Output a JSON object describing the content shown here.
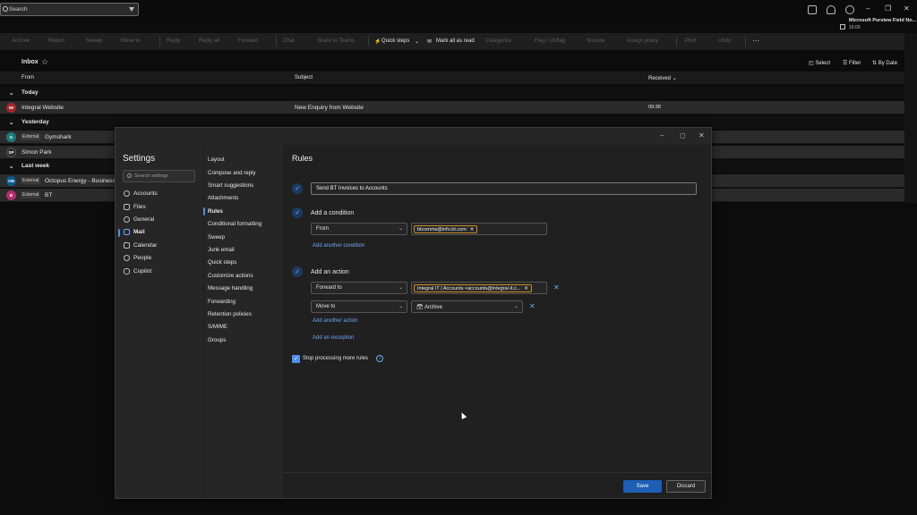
{
  "search": {
    "placeholder": "Search"
  },
  "purview": {
    "title": "Microsoft Purview Field No...",
    "time": "15:00"
  },
  "toolbar": {
    "archive": "Archive",
    "report": "Report",
    "sweep": "Sweep",
    "move_to": "Move to",
    "reply": "Reply",
    "reply_all": "Reply all",
    "forward": "Forward",
    "chat": "Chat",
    "share_teams": "Share to Teams",
    "quick_steps": "Quick steps",
    "mark_all_read": "Mark all as read",
    "categorize": "Categorize",
    "flag": "Flag / Unflag",
    "snooze": "Snooze",
    "assign_policy": "Assign policy",
    "print": "Print",
    "undo": "Undo",
    "more": "···"
  },
  "inbox": {
    "title": "Inbox",
    "select": "Select",
    "filter": "Filter",
    "by_date": "By Date"
  },
  "columns": {
    "from": "From",
    "subject": "Subject",
    "received": "Received"
  },
  "groups": {
    "today": "Today",
    "yesterday": "Yesterday",
    "last_week": "Last week"
  },
  "messages": [
    {
      "initials": "IW",
      "from": "Integral Website",
      "subject": "New Enquiry from Website",
      "received": "09:38",
      "external": "",
      "color": "#a4262c"
    },
    {
      "initials": "G",
      "from": "Gymshark",
      "external": "External",
      "color": "#1f7a7a"
    },
    {
      "initials": "SP",
      "from": "Simon Park",
      "external": "",
      "color": "#2b2b2b"
    },
    {
      "initials": "OB",
      "from": "Octopus Energy - Business",
      "external": "External",
      "color": "#0e5a8a"
    },
    {
      "initials": "B",
      "from": "BT",
      "external": "External",
      "color": "#b0306b"
    }
  ],
  "settings": {
    "title": "Settings",
    "search_placeholder": "Search settings",
    "nav": [
      "Accounts",
      "Files",
      "General",
      "Mail",
      "Calendar",
      "People",
      "Copilot"
    ],
    "subnav": [
      "Layout",
      "Compose and reply",
      "Smart suggestions",
      "Attachments",
      "Rules",
      "Conditional formatting",
      "Sweep",
      "Junk email",
      "Quick steps",
      "Customize actions",
      "Message handling",
      "Forwarding",
      "Retention policies",
      "S/MIME",
      "Groups"
    ]
  },
  "rules": {
    "title": "Rules",
    "rule_name": "Send BT Invoices to Accounts",
    "add_condition": "Add a condition",
    "condition_type": "From",
    "condition_value": "btcomms@info.bt.com",
    "add_another_condition": "Add another condition",
    "add_action": "Add an action",
    "action1_type": "Forward to",
    "action1_value": "Integral IT | Accounts <accounts@integral-it.c...",
    "action2_type": "Move to",
    "action2_value": "Archive",
    "add_another_action": "Add another action",
    "add_exception": "Add an exception",
    "stop_processing": "Stop processing more rules",
    "save": "Save",
    "discard": "Discard"
  }
}
